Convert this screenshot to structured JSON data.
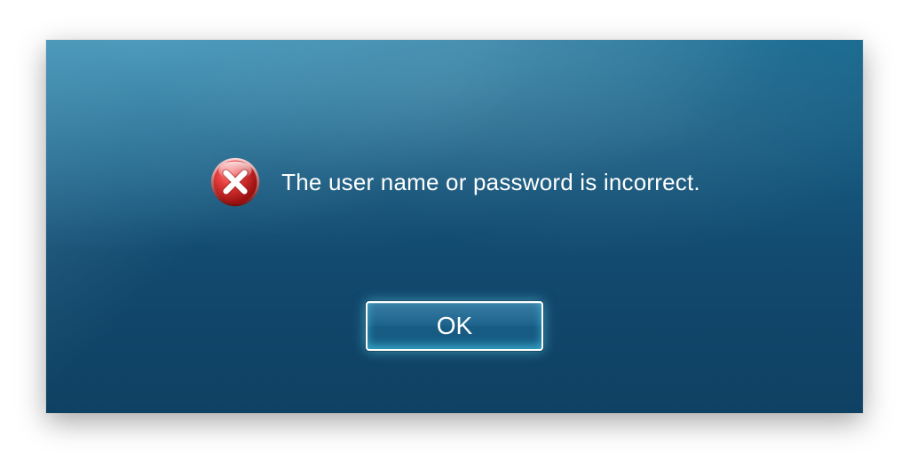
{
  "dialog": {
    "message": "The user name or password is incorrect.",
    "ok_label": "OK"
  }
}
